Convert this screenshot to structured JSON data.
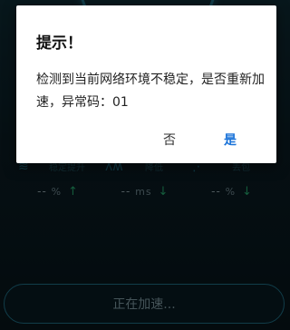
{
  "dialog": {
    "title": "提示！",
    "message": "检测到当前网络环境不稳定，是否重新加速，异常码：01",
    "no_label": "否",
    "yes_label": "是"
  },
  "metrics": [
    {
      "label": "稳定提升",
      "value": "--",
      "unit": "%",
      "trend": "up"
    },
    {
      "label": "降低",
      "value": "--",
      "unit": "ms",
      "trend": "down"
    },
    {
      "label": "丢包",
      "value": "--",
      "unit": "%",
      "trend": "down"
    }
  ],
  "accelerate_button": "正在加速...",
  "colors": {
    "accent": "#1a73d9",
    "trend": "#27a86e",
    "ring": "#1f6f86"
  }
}
